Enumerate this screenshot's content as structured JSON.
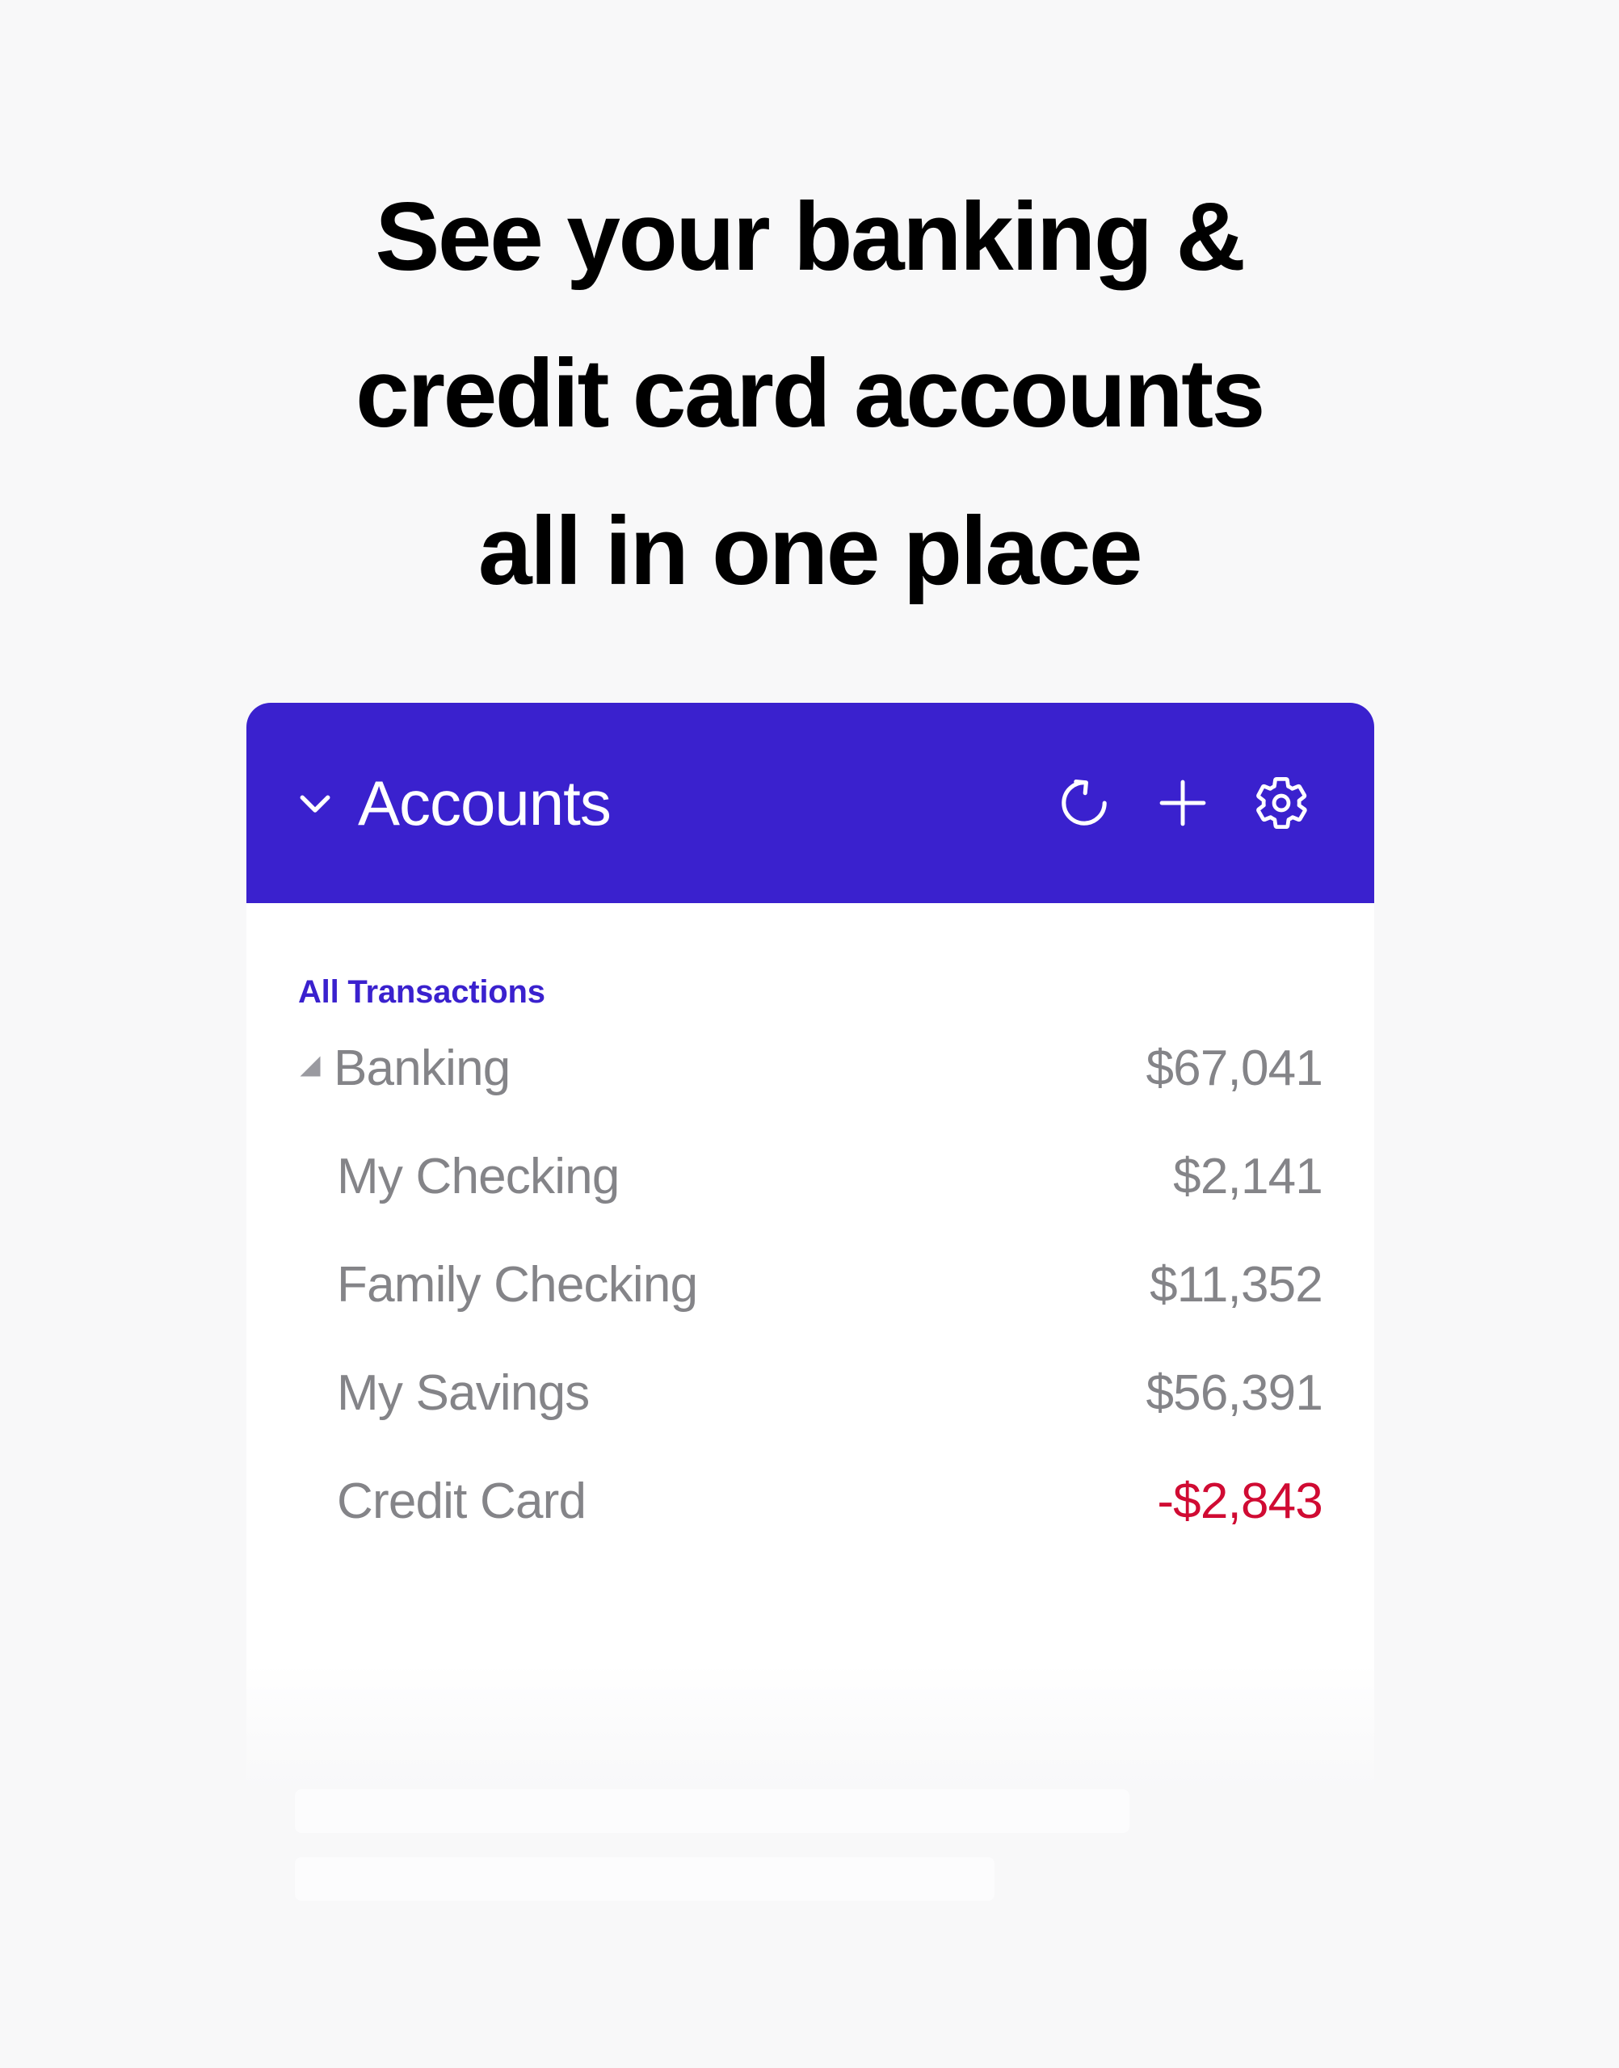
{
  "page": {
    "background_color": "#F8F8F9",
    "headline_lines": [
      "See your banking &",
      "credit card accounts",
      "all in one place"
    ]
  },
  "card": {
    "header": {
      "title": "Accounts",
      "background_color": "#3A21CE",
      "title_color": "#FFFFFF",
      "collapse_icon": "chevron-down-icon",
      "actions": [
        {
          "name": "refresh-button",
          "icon": "refresh-icon",
          "label": "Refresh"
        },
        {
          "name": "add-account-button",
          "icon": "plus-icon",
          "label": "Add"
        },
        {
          "name": "settings-button",
          "icon": "gear-icon",
          "label": "Settings"
        }
      ]
    },
    "body": {
      "all_transactions_label": "All Transactions",
      "all_transactions_color": "#3A21CE",
      "default_text_color": "#848488",
      "negative_color": "#D00B33",
      "rows": [
        {
          "name": "Banking",
          "amount": "$67,041",
          "level": "group",
          "negative": false,
          "disclosure_icon": "disclosure-triangle-icon"
        },
        {
          "name": "My Checking",
          "amount": "$2,141",
          "level": "child",
          "negative": false
        },
        {
          "name": "Family Checking",
          "amount": "$11,352",
          "level": "child",
          "negative": false
        },
        {
          "name": "My Savings",
          "amount": "$56,391",
          "level": "child",
          "negative": false
        },
        {
          "name": "Credit Card",
          "amount": "-$2,843",
          "level": "child",
          "negative": true
        }
      ]
    }
  }
}
